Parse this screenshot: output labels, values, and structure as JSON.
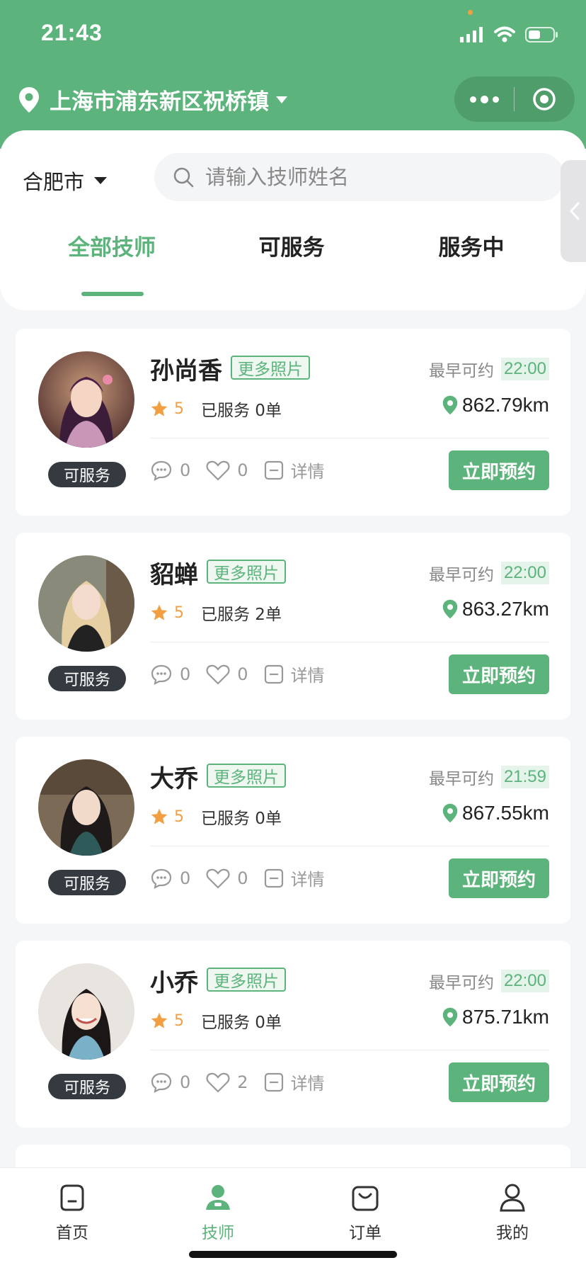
{
  "status_bar": {
    "time": "21:43"
  },
  "header": {
    "location": "上海市浦东新区祝桥镇"
  },
  "filter": {
    "city": "合肥市",
    "search_placeholder": "请输入技师姓名"
  },
  "tabs": [
    {
      "label": "全部技师",
      "active": true
    },
    {
      "label": "可服务",
      "active": false
    },
    {
      "label": "服务中",
      "active": false
    }
  ],
  "card_labels": {
    "more_photos": "更多照片",
    "earliest": "最早可约",
    "details": "详情",
    "book": "立即预约"
  },
  "technicians": [
    {
      "name": "孙尚香",
      "earliest_time": "22:00",
      "rating": "5",
      "served": "已服务 0单",
      "distance": "862.79km",
      "comments": "0",
      "likes": "0",
      "status": "可服务"
    },
    {
      "name": "貂蝉",
      "earliest_time": "22:00",
      "rating": "5",
      "served": "已服务 2单",
      "distance": "863.27km",
      "comments": "0",
      "likes": "0",
      "status": "可服务"
    },
    {
      "name": "大乔",
      "earliest_time": "21:59",
      "rating": "5",
      "served": "已服务 0单",
      "distance": "867.55km",
      "comments": "0",
      "likes": "0",
      "status": "可服务"
    },
    {
      "name": "小乔",
      "earliest_time": "22:00",
      "rating": "5",
      "served": "已服务 0单",
      "distance": "875.71km",
      "comments": "0",
      "likes": "2",
      "status": "可服务"
    }
  ],
  "bottom_nav": [
    {
      "label": "首页",
      "icon": "home-icon",
      "active": false
    },
    {
      "label": "技师",
      "icon": "technician-icon",
      "active": true
    },
    {
      "label": "订单",
      "icon": "order-bag-icon",
      "active": false
    },
    {
      "label": "我的",
      "icon": "profile-icon",
      "active": false
    }
  ],
  "colors": {
    "brand_green": "#5cb37b",
    "badge_dark": "#343a40",
    "star_orange": "#f0a040"
  }
}
